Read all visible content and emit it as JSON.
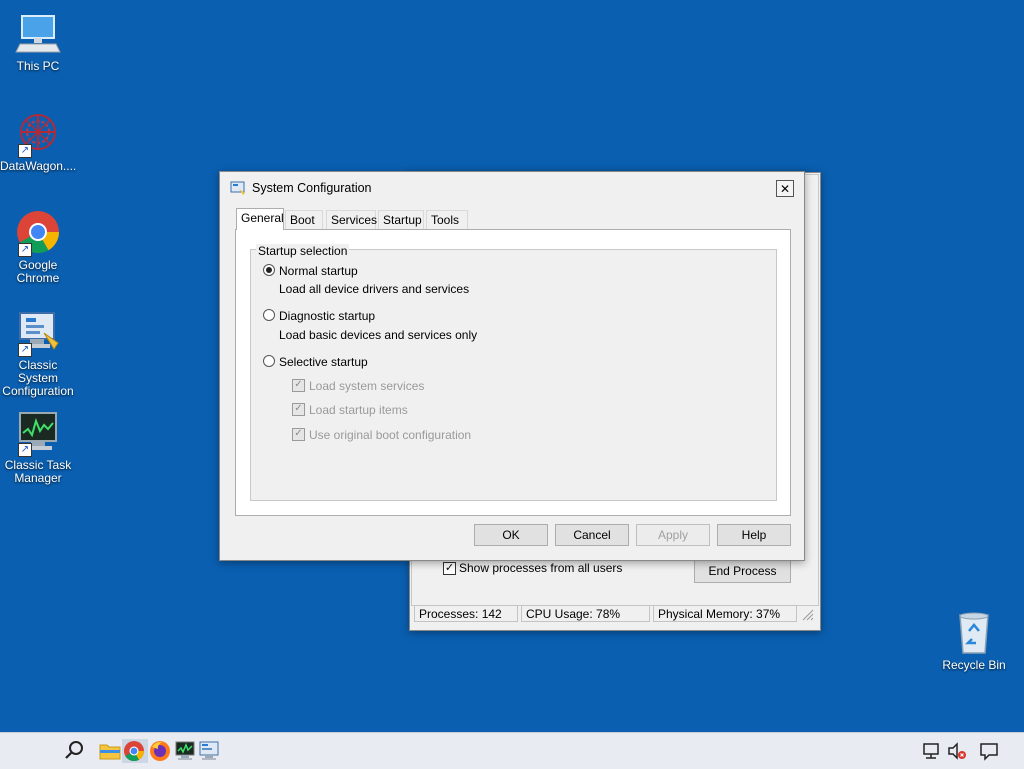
{
  "desktop": {
    "icons": [
      {
        "label": "This PC"
      },
      {
        "label": "DataWagon...."
      },
      {
        "label": "Google Chrome"
      },
      {
        "label": "Classic System Configuration"
      },
      {
        "label": "Classic Task Manager"
      },
      {
        "label": "Recycle Bin"
      }
    ]
  },
  "task_manager": {
    "show_all_label": "Show processes from all users",
    "show_all_checked": true,
    "end_process_label": "End Process",
    "status": {
      "processes": "Processes: 142",
      "cpu": "CPU Usage: 78%",
      "memory": "Physical Memory: 37%"
    }
  },
  "sysconfig": {
    "title": "System Configuration",
    "close_symbol": "✕",
    "tabs": [
      "General",
      "Boot",
      "Services",
      "Startup",
      "Tools"
    ],
    "active_tab": "General",
    "group_label": "Startup selection",
    "normal": {
      "label": "Normal startup",
      "desc": "Load all device drivers and services",
      "checked": true
    },
    "diagnostic": {
      "label": "Diagnostic startup",
      "desc": "Load basic devices and services only",
      "checked": false
    },
    "selective": {
      "label": "Selective startup",
      "checked": false,
      "options": [
        "Load system services",
        "Load startup items",
        "Use original boot configuration"
      ]
    },
    "buttons": {
      "ok": "OK",
      "cancel": "Cancel",
      "apply": "Apply",
      "help": "Help"
    }
  },
  "taskbar": {
    "pinned": [
      "search-icon",
      "file-explorer-icon",
      "chrome-icon",
      "firefox-icon",
      "task-manager-icon",
      "system-config-icon"
    ],
    "tray": [
      "network-icon",
      "volume-muted-icon",
      "notification-icon"
    ]
  },
  "colors": {
    "desktop": "#0a5fb0",
    "taskbar": "#e8ecf2"
  }
}
